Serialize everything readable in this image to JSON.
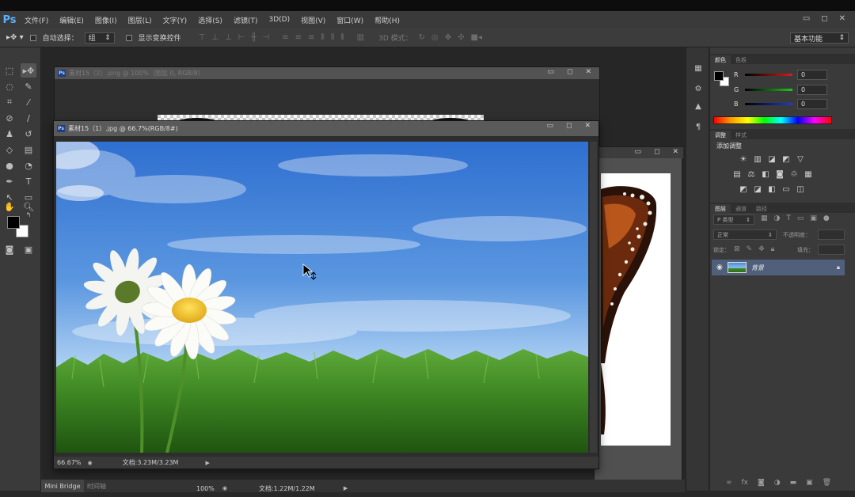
{
  "app": {
    "logo": "Ps",
    "menu": [
      "文件(F)",
      "编辑(E)",
      "图像(I)",
      "图层(L)",
      "文字(Y)",
      "选择(S)",
      "滤镜(T)",
      "3D(D)",
      "视图(V)",
      "窗口(W)",
      "帮助(H)"
    ],
    "window_controls": [
      "▭",
      "◻",
      "✕"
    ]
  },
  "options_bar": {
    "auto_select_label": "自动选择：",
    "auto_select_value": "组",
    "transform_label": "显示变换控件",
    "mode_3d_label": "3D 模式：",
    "workspace": "基本功能"
  },
  "documents": {
    "doc1": {
      "title": "素材15（2）.png @ 100%（图层 0, RGB/8）"
    },
    "doc2": {
      "title": "素材15（1）.jpg @ 66.7%(RGB/8#)",
      "zoom": "66.67%",
      "doc_size": "文档:3.23M/3.23M"
    },
    "doc3": {
      "zoom": "100%",
      "doc_size": "文档:1.22M/1.22M"
    }
  },
  "bottom": {
    "mini_bridge": "Mini Bridge",
    "timeline": "时间轴"
  },
  "panels": {
    "color_tabs": [
      "颜色",
      "色板"
    ],
    "sliders": [
      {
        "label": "R",
        "value": "0",
        "color": "#d21e1e"
      },
      {
        "label": "G",
        "value": "0",
        "color": "#1ec81e"
      },
      {
        "label": "B",
        "value": "0",
        "color": "#1e3cd2"
      }
    ],
    "adjust_tabs": [
      "调整",
      "样式"
    ],
    "adjust_title": "添加调整",
    "layer_tabs": [
      "图层",
      "通道",
      "路径"
    ],
    "layer_filter": "P 类型",
    "blend_mode": "正常",
    "opacity_label": "不透明度：",
    "lock_label": "锁定：",
    "fill_label": "填充：",
    "layer_name": "背景"
  }
}
